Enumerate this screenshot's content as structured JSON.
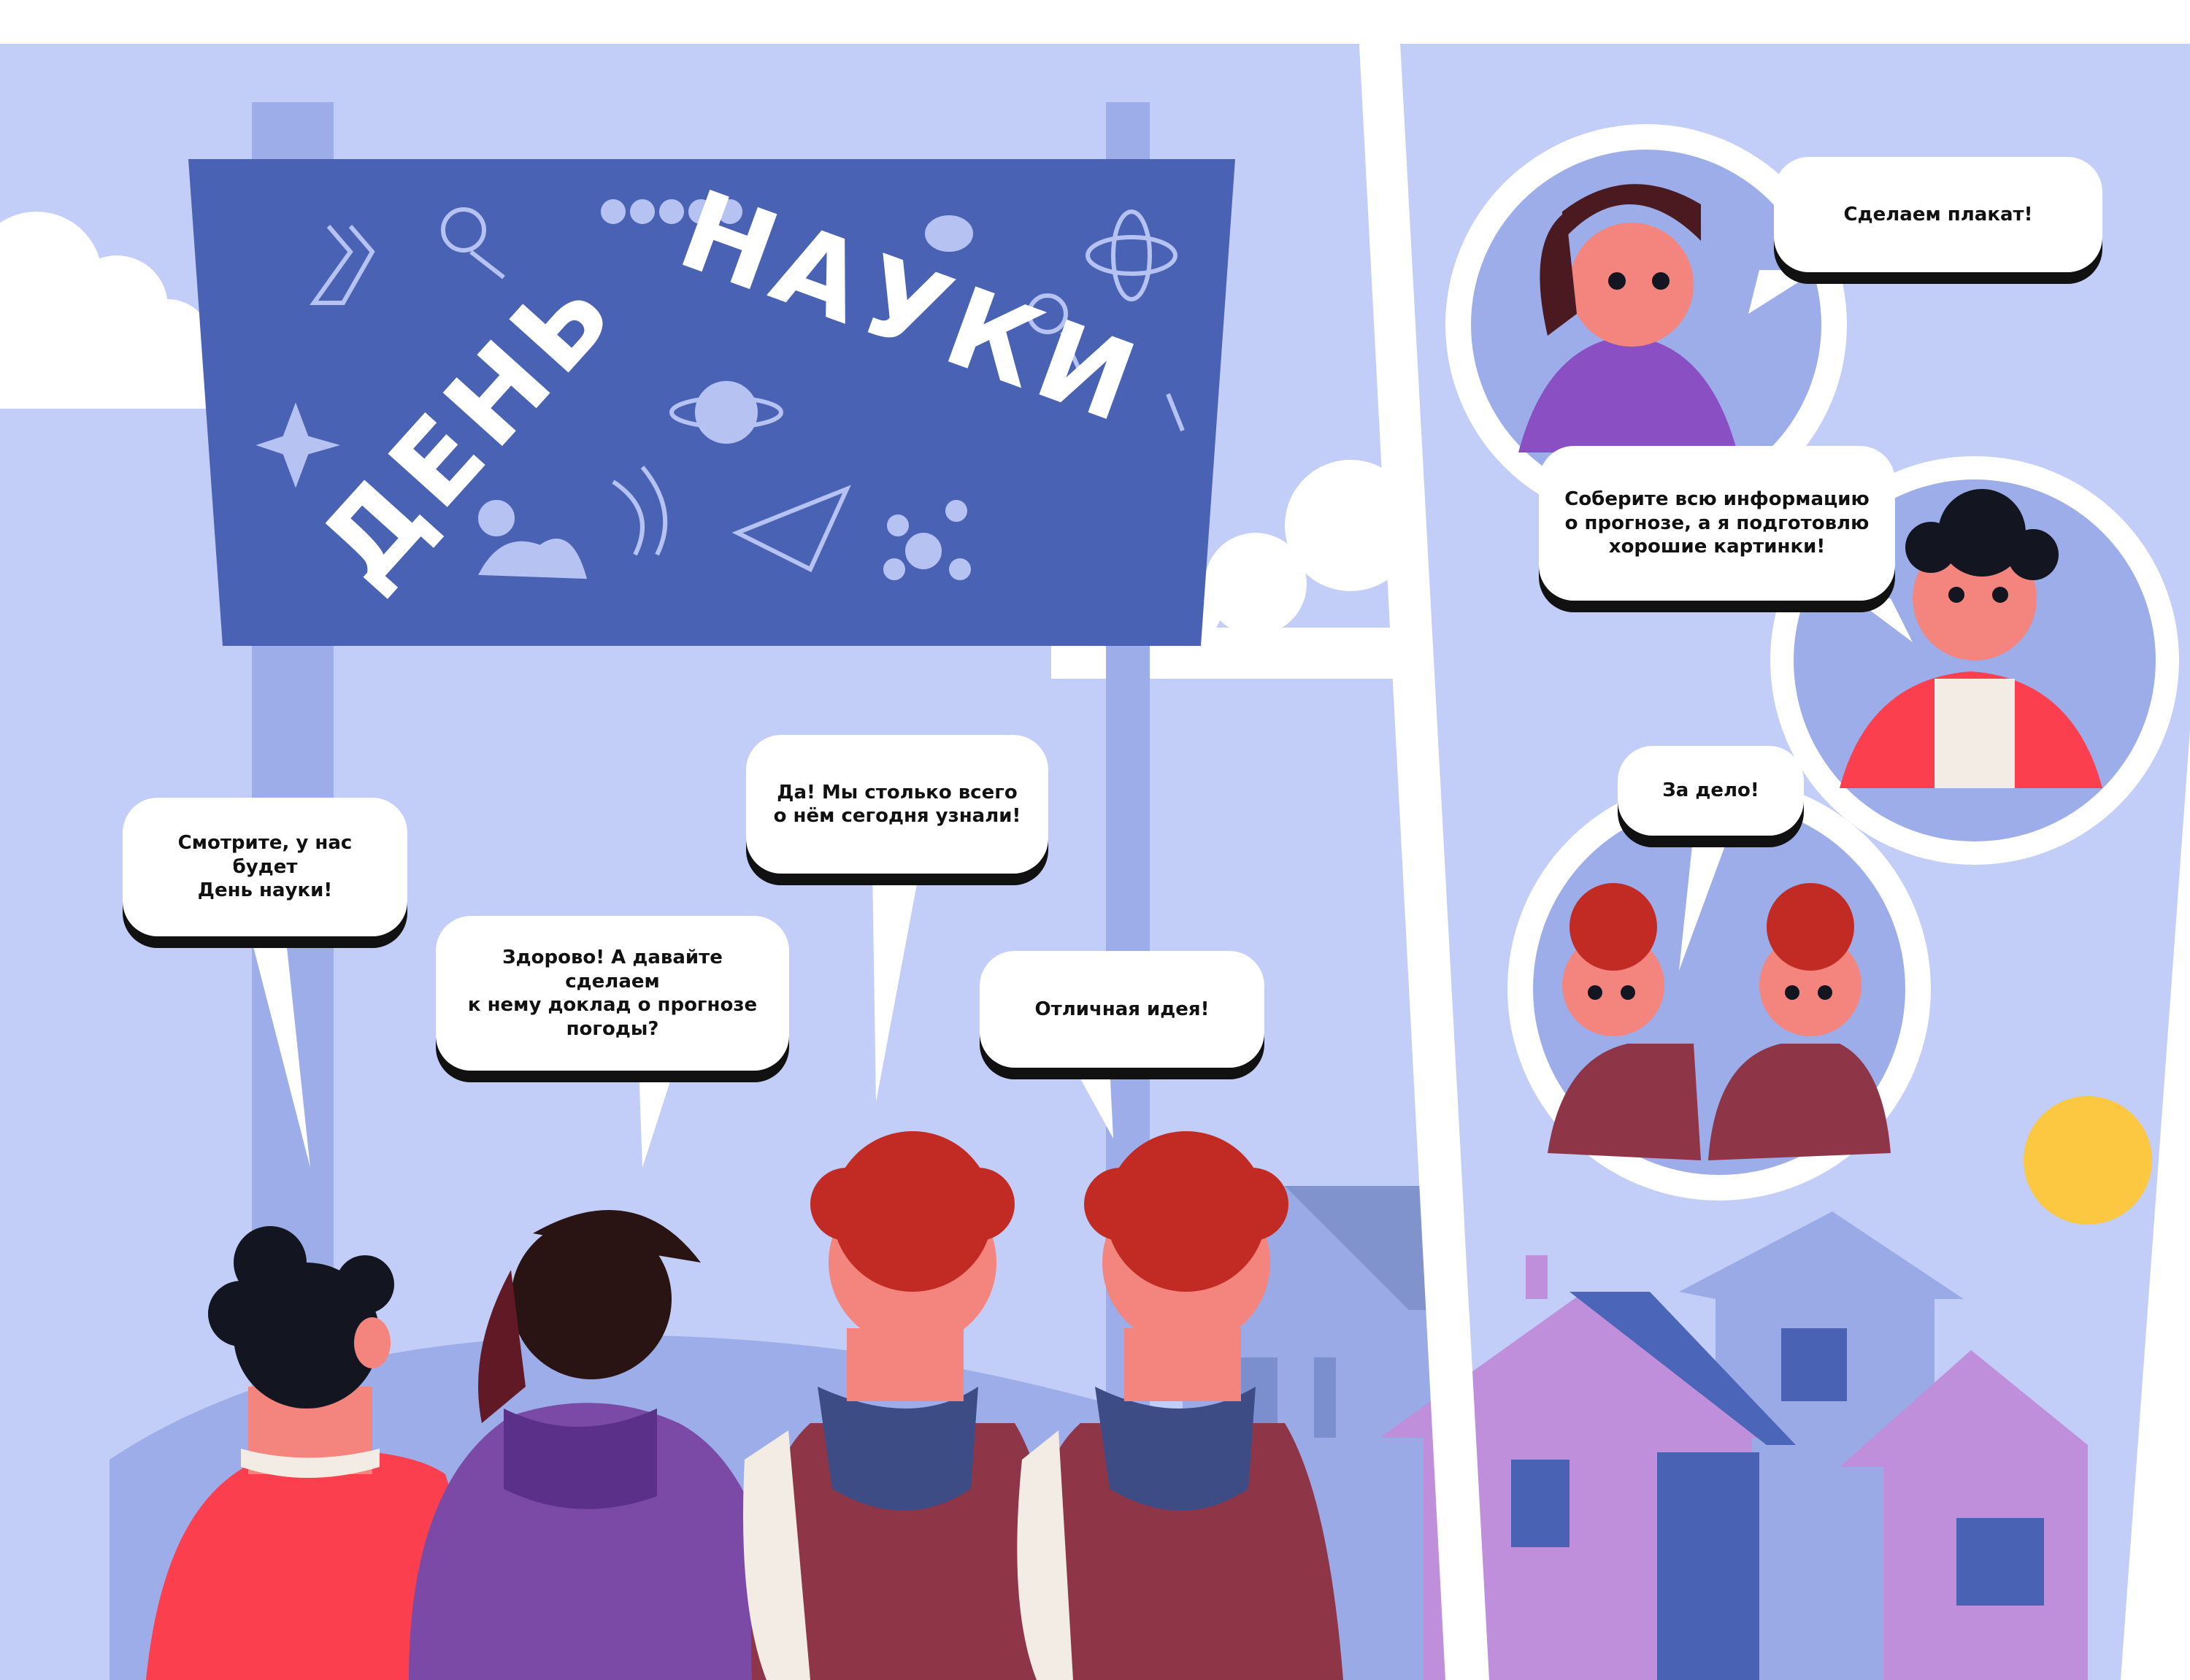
{
  "sign": {
    "title_word1": "ДЕНЬ",
    "title_word2": "НАУКИ"
  },
  "bubbles": {
    "b1": "Смотрите, у нас будет\nДень науки!",
    "b2": "Здорово! А давайте сделаем\nк нему доклад о прогнозе\nпогоды?",
    "b3": "Да! Мы столько всего\nо нём сегодня узнали!",
    "b4": "Отличная идея!",
    "b5": "Сделаем плакат!",
    "b6": "Соберите всю информацию\nо прогнозе, а я подготовлю\nхорошие картинки!",
    "b7": "За дело!"
  },
  "colors": {
    "sky": "#c2cdf8",
    "sign": "#4a62b4",
    "pole": "#9dadea",
    "sun": "#fcc841",
    "house_purple": "#c08fdc",
    "house_blue": "#9aaae6",
    "roof": "#4b65b8"
  }
}
